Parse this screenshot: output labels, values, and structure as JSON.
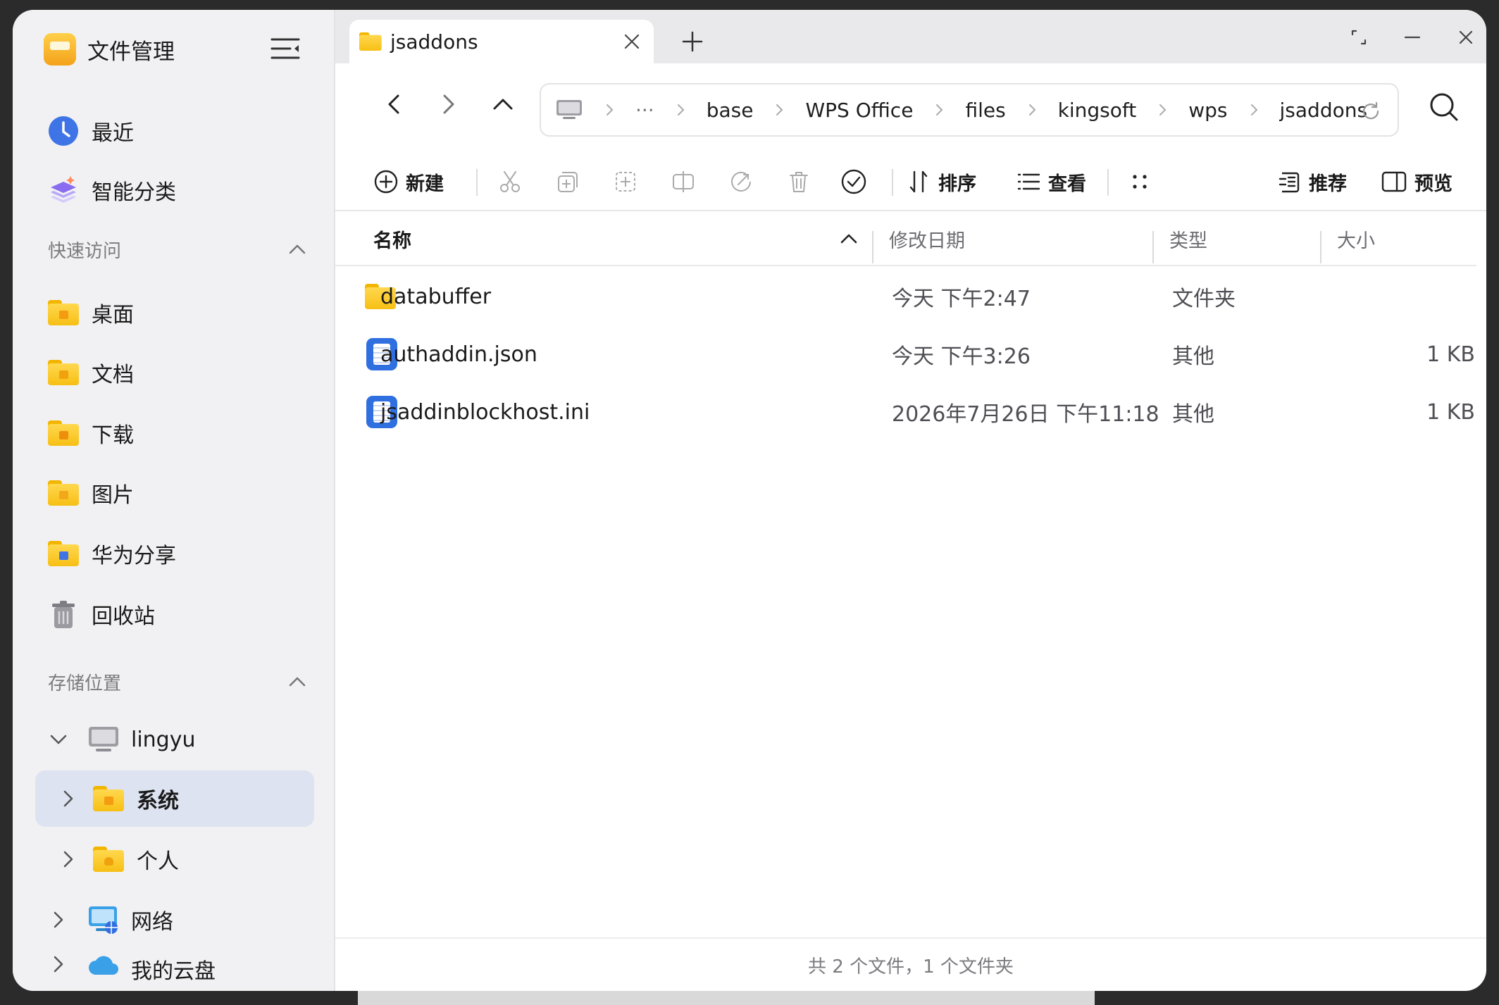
{
  "app": {
    "title": "文件管理"
  },
  "sidebar": {
    "top_items": [
      {
        "label": "最近",
        "icon": "clock-icon"
      },
      {
        "label": "智能分类",
        "icon": "smart-category-icon"
      }
    ],
    "quick_access": {
      "title": "快速访问",
      "items": [
        {
          "label": "桌面",
          "icon": "desktop-folder-icon"
        },
        {
          "label": "文档",
          "icon": "documents-folder-icon"
        },
        {
          "label": "下载",
          "icon": "downloads-folder-icon"
        },
        {
          "label": "图片",
          "icon": "pictures-folder-icon"
        },
        {
          "label": "华为分享",
          "icon": "huawei-share-folder-icon"
        },
        {
          "label": "回收站",
          "icon": "trash-icon"
        }
      ]
    },
    "storage": {
      "title": "存储位置",
      "items": [
        {
          "label": "lingyu",
          "icon": "computer-icon",
          "expanded": true
        },
        {
          "label": "系统",
          "icon": "system-folder-icon",
          "selected": true
        },
        {
          "label": "个人",
          "icon": "personal-folder-icon"
        },
        {
          "label": "网络",
          "icon": "network-icon"
        },
        {
          "label": "我的云盘",
          "icon": "cloud-icon"
        }
      ]
    }
  },
  "tab": {
    "label": "jsaddons"
  },
  "breadcrumb": {
    "ellipsis": "···",
    "items": [
      "base",
      "WPS Office",
      "files",
      "kingsoft",
      "wps",
      "jsaddons"
    ]
  },
  "toolbar": {
    "new_label": "新建",
    "sort_label": "排序",
    "view_label": "查看",
    "recommend_label": "推荐",
    "preview_label": "预览"
  },
  "columns": {
    "name": "名称",
    "date": "修改日期",
    "type": "类型",
    "size": "大小"
  },
  "files": [
    {
      "name": "databuffer",
      "date": "今天 下午2:47",
      "type": "文件夹",
      "size": "",
      "kind": "folder"
    },
    {
      "name": "authaddin.json",
      "date": "今天 下午3:26",
      "type": "其他",
      "size": "1 KB",
      "kind": "doc"
    },
    {
      "name": "jsaddinblockhost.ini",
      "date": "2026年7月26日 下午11:18",
      "type": "其他",
      "size": "1 KB",
      "kind": "doc"
    }
  ],
  "status": "共 2 个文件，1 个文件夹",
  "colors": {
    "selected_bg": "#dde3f1",
    "folder": "#f7bf14",
    "doc_blue": "#2f6fe0"
  }
}
